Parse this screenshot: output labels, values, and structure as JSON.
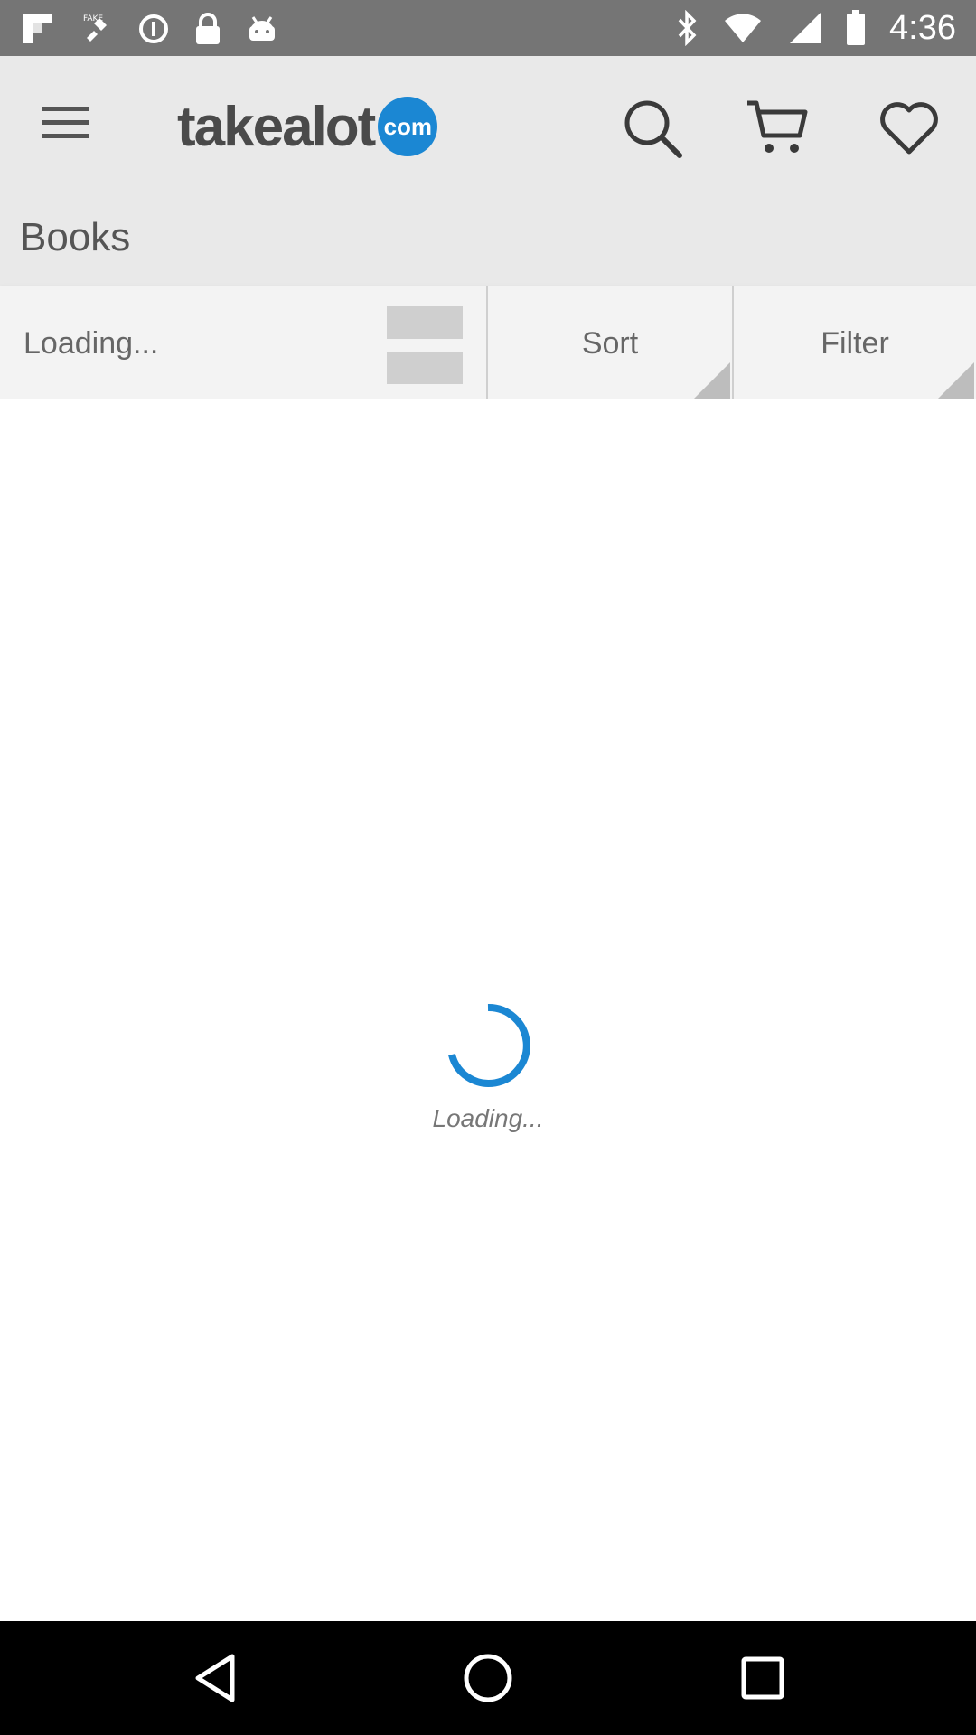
{
  "status_bar": {
    "time": "4:36",
    "left_icons": [
      "flipboard-icon",
      "fake-gps-icon",
      "data-saver-icon",
      "lock-icon",
      "android-icon"
    ],
    "right_icons": [
      "bluetooth-icon",
      "wifi-icon",
      "signal-icon",
      "battery-icon"
    ]
  },
  "app_bar": {
    "logo_text": "takealot",
    "logo_badge": "com",
    "page_title": "Books",
    "brand_color": "#1b87d3"
  },
  "toolbar": {
    "loading_label": "Loading...",
    "sort_label": "Sort",
    "filter_label": "Filter"
  },
  "content": {
    "loading_text": "Loading...",
    "spinner_color": "#1b87d3"
  },
  "nav_bar": {
    "icons": [
      "back-icon",
      "home-icon",
      "recents-icon"
    ]
  }
}
